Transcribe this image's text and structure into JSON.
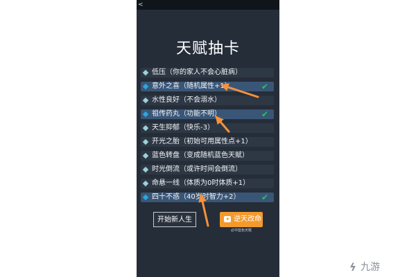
{
  "app": {
    "back_glyph": "<"
  },
  "page": {
    "title": "天赋抽卡"
  },
  "talents": [
    {
      "label": "低压（你的家人不会心脏病）",
      "selected": false,
      "checked": false
    },
    {
      "label": "意外之喜（随机属性+1）",
      "selected": true,
      "checked": true
    },
    {
      "label": "水性良好（不会溺水）",
      "selected": false,
      "checked": false
    },
    {
      "label": "祖传药丸（功能不明）",
      "selected": true,
      "checked": true
    },
    {
      "label": "天生抑郁（快乐-3）",
      "selected": false,
      "checked": false
    },
    {
      "label": "开光之胎（初始可用属性点+1）",
      "selected": false,
      "checked": false
    },
    {
      "label": "蓝色转盘（变成随机蓝色天赋）",
      "selected": false,
      "checked": false
    },
    {
      "label": "时光倒流（或许时间会倒流）",
      "selected": false,
      "checked": false
    },
    {
      "label": "命悬一线（体质为0时体质+1）",
      "selected": false,
      "checked": false
    },
    {
      "label": "四十不惑（40岁时智力+2）",
      "selected": true,
      "checked": true
    }
  ],
  "check_glyph": "✔",
  "buttons": {
    "start_label": "开始新人生",
    "reverse_label": "逆天改命",
    "reverse_sub": "必中蓝色天赋"
  },
  "watermark": {
    "icon_glyph": "ϟ",
    "text": "九游"
  },
  "colors": {
    "background": "#252d38",
    "selected_row": "#3a5677",
    "row": "#2e3744",
    "check": "#22c55e",
    "arrow": "#f5923e",
    "accent_button": "#f39a2e"
  }
}
